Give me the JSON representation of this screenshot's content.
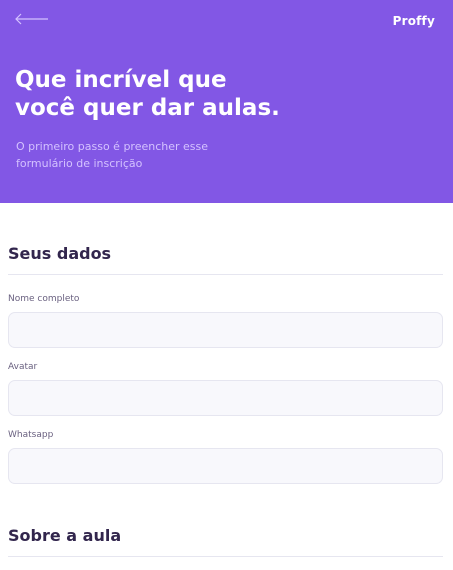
{
  "header": {
    "back_icon": "arrow-left-icon",
    "logo_text": "Proffy",
    "title_line1": "Que incrível que",
    "title_line2": "você quer dar aulas.",
    "subtitle_line1": "O primeiro passo é preencher esse",
    "subtitle_line2": "formulário de inscrição"
  },
  "personal_section": {
    "title": "Seus dados",
    "fields": [
      {
        "label": "Nome completo",
        "value": ""
      },
      {
        "label": "Avatar",
        "value": ""
      },
      {
        "label": "Whatsapp",
        "value": ""
      }
    ]
  },
  "class_section": {
    "title": "Sobre a aula"
  },
  "colors": {
    "primary": "#8257e5",
    "title_text": "#32264d",
    "label_text": "#6a6180",
    "input_bg": "#f8f8fc",
    "input_border": "#e6e6f0"
  }
}
